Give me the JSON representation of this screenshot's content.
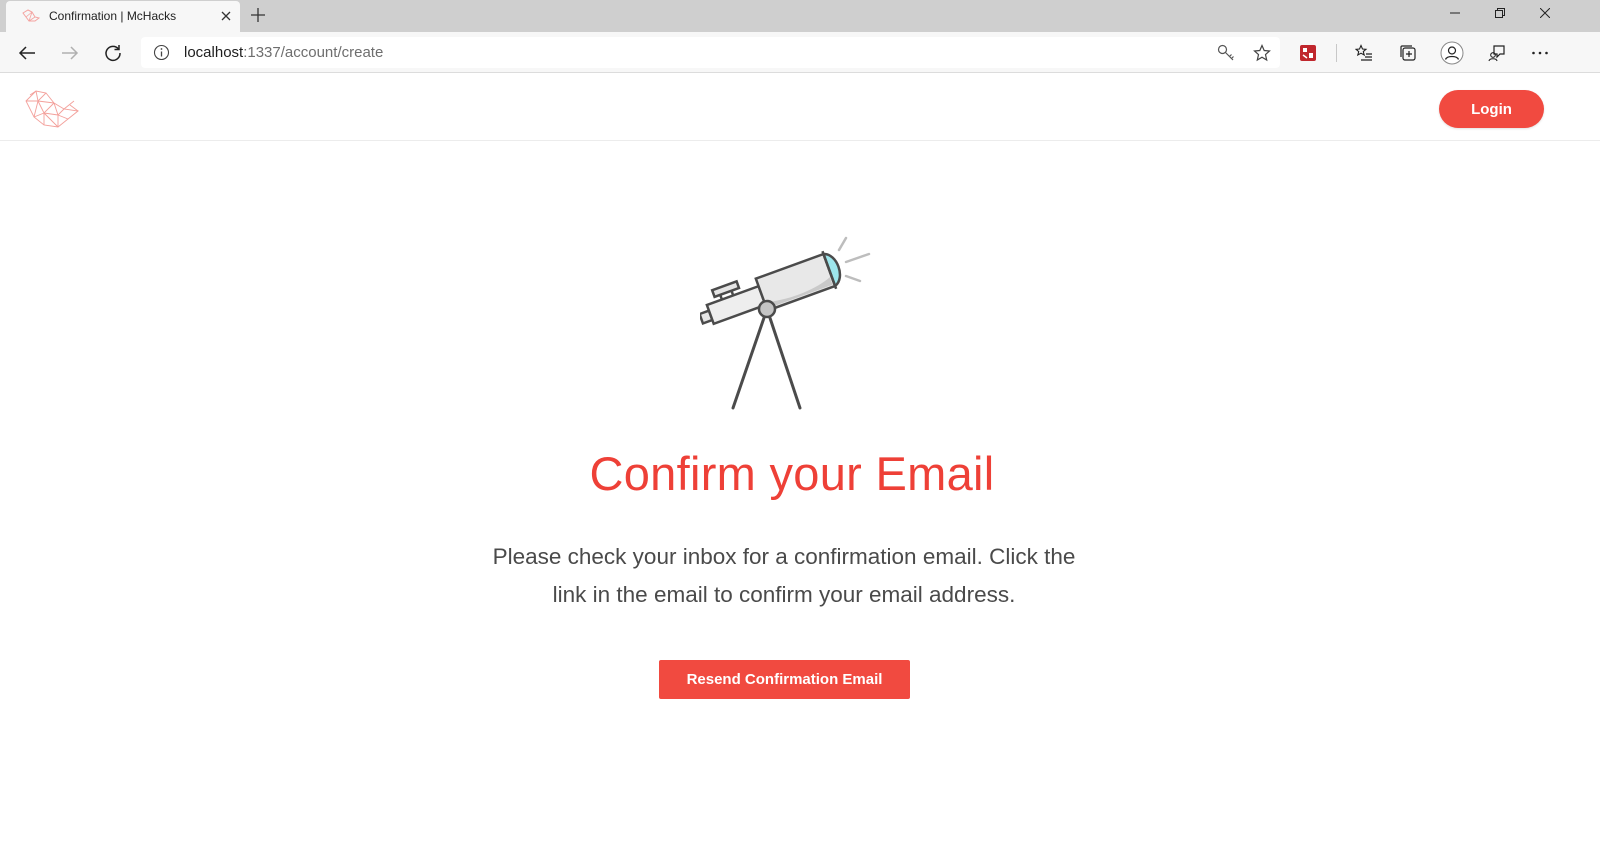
{
  "browser": {
    "tab": {
      "title": "Confirmation | McHacks"
    },
    "address_bar": {
      "host": "localhost",
      "path": ":1337/account/create"
    },
    "icons": {
      "favicon": "mchacks-bird-icon",
      "close": "close-icon",
      "new_tab": "plus-icon",
      "back": "back-arrow-icon",
      "forward": "forward-arrow-icon",
      "refresh": "refresh-icon",
      "info": "info-icon",
      "key": "key-icon",
      "favorite": "star-icon",
      "extension": "extension-icon",
      "favorites_list": "favorites-list-icon",
      "collections": "collections-icon",
      "profile": "profile-icon",
      "feedback": "feedback-icon",
      "more": "more-icon"
    }
  },
  "header": {
    "logo": "mchacks-bird-logo",
    "login_label": "Login"
  },
  "main": {
    "illustration": "telescope-illustration",
    "title": "Confirm your Email",
    "message": "Please check your inbox for a confirmation email. Click the link in the email to confirm your email address.",
    "resend_label": "Resend Confirmation Email"
  },
  "colors": {
    "accent": "#ee4037",
    "button": "#f14a40",
    "text": "#4a4a4a",
    "telescope_lens": "#9ee6ec"
  }
}
